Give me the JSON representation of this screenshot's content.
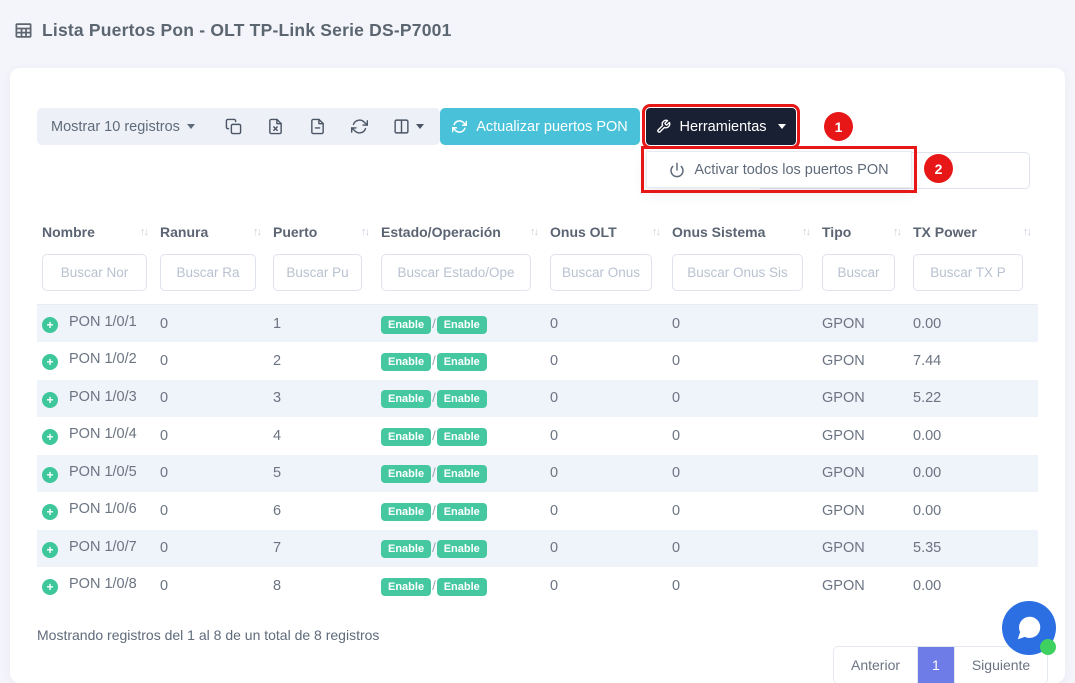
{
  "page_title": "Lista Puertos Pon - OLT TP-Link Serie DS-P7001",
  "toolbar": {
    "show_entries_label": "Mostrar 10 registros",
    "icon_buttons": [
      "copy",
      "excel-export",
      "file-export",
      "refresh",
      "column-visibility"
    ],
    "update_button": "Actualizar puertos PON",
    "tools_button": "Herramientas",
    "tools_menu": {
      "activate_all": "Activar todos los puertos PON"
    },
    "search_value": ""
  },
  "annotations": {
    "step1": "1",
    "step2": "2"
  },
  "table": {
    "columns": [
      {
        "label": "Nombre",
        "filter_placeholder": "Buscar Nor"
      },
      {
        "label": "Ranura",
        "filter_placeholder": "Buscar Ra"
      },
      {
        "label": "Puerto",
        "filter_placeholder": "Buscar Pu"
      },
      {
        "label": "Estado/Operación",
        "filter_placeholder": "Buscar Estado/Ope"
      },
      {
        "label": "Onus OLT",
        "filter_placeholder": "Buscar Onus"
      },
      {
        "label": "Onus Sistema",
        "filter_placeholder": "Buscar Onus Sis"
      },
      {
        "label": "Tipo",
        "filter_placeholder": "Buscar"
      },
      {
        "label": "TX Power",
        "filter_placeholder": "Buscar TX P"
      }
    ],
    "rows": [
      {
        "name": "PON 1/0/1",
        "ranura": "0",
        "puerto": "1",
        "estado": "Enable",
        "operacion": "Enable",
        "onus_olt": "0",
        "onus_sistema": "0",
        "tipo": "GPON",
        "tx_power": "0.00"
      },
      {
        "name": "PON 1/0/2",
        "ranura": "0",
        "puerto": "2",
        "estado": "Enable",
        "operacion": "Enable",
        "onus_olt": "0",
        "onus_sistema": "0",
        "tipo": "GPON",
        "tx_power": "7.44"
      },
      {
        "name": "PON 1/0/3",
        "ranura": "0",
        "puerto": "3",
        "estado": "Enable",
        "operacion": "Enable",
        "onus_olt": "0",
        "onus_sistema": "0",
        "tipo": "GPON",
        "tx_power": "5.22"
      },
      {
        "name": "PON 1/0/4",
        "ranura": "0",
        "puerto": "4",
        "estado": "Enable",
        "operacion": "Enable",
        "onus_olt": "0",
        "onus_sistema": "0",
        "tipo": "GPON",
        "tx_power": "0.00"
      },
      {
        "name": "PON 1/0/5",
        "ranura": "0",
        "puerto": "5",
        "estado": "Enable",
        "operacion": "Enable",
        "onus_olt": "0",
        "onus_sistema": "0",
        "tipo": "GPON",
        "tx_power": "0.00"
      },
      {
        "name": "PON 1/0/6",
        "ranura": "0",
        "puerto": "6",
        "estado": "Enable",
        "operacion": "Enable",
        "onus_olt": "0",
        "onus_sistema": "0",
        "tipo": "GPON",
        "tx_power": "0.00"
      },
      {
        "name": "PON 1/0/7",
        "ranura": "0",
        "puerto": "7",
        "estado": "Enable",
        "operacion": "Enable",
        "onus_olt": "0",
        "onus_sistema": "0",
        "tipo": "GPON",
        "tx_power": "5.35"
      },
      {
        "name": "PON 1/0/8",
        "ranura": "0",
        "puerto": "8",
        "estado": "Enable",
        "operacion": "Enable",
        "onus_olt": "0",
        "onus_sistema": "0",
        "tipo": "GPON",
        "tx_power": "0.00"
      }
    ]
  },
  "footer": {
    "info": "Mostrando registros del 1 al 8 de un total de 8 registros",
    "pagination": {
      "previous": "Anterior",
      "current": "1",
      "next": "Siguiente"
    }
  },
  "colors": {
    "update_button": "#49c2d9",
    "tools_button": "#1a2033",
    "annotation_red": "#e81717",
    "badge_green": "#45c8a0",
    "expand_green": "#3fc79c",
    "pagination_active": "#6d7ce6",
    "chat_blue": "#2c6fe2",
    "online_green": "#3ed160"
  }
}
